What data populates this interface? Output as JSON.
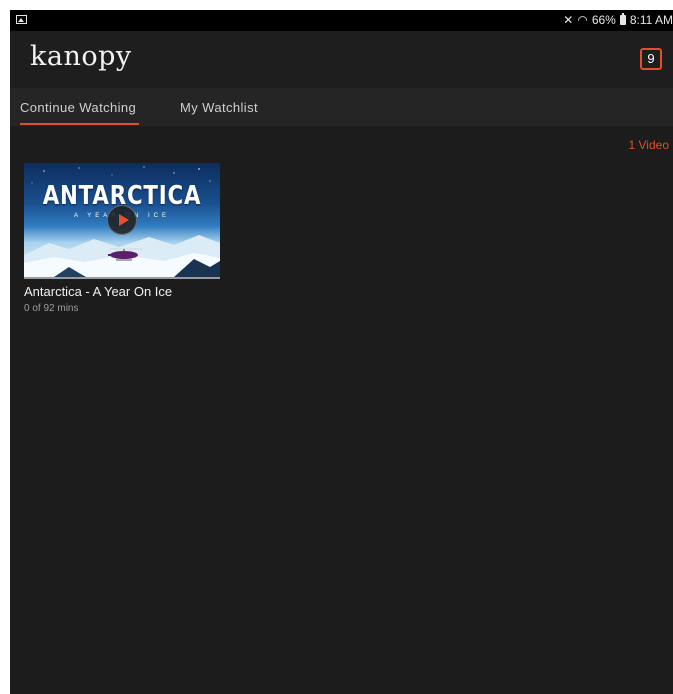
{
  "status_bar": {
    "battery": "66%",
    "time": "8:11 AM",
    "icons": [
      "gallery-icon",
      "mute-icon",
      "wifi-icon",
      "battery-icon"
    ]
  },
  "header": {
    "logo": "kanopy",
    "badge_count": "9"
  },
  "tabs": [
    {
      "label": "Continue Watching",
      "active": true
    },
    {
      "label": "My Watchlist",
      "active": false
    }
  ],
  "content": {
    "video_count": "1 Video",
    "videos": [
      {
        "title": "Antarctica - A Year On Ice",
        "meta": "0 of 92 mins",
        "thumbnail_title": "ANTARCTICA",
        "thumbnail_subtitle": "A YEAR ON ICE",
        "progress": 0
      }
    ]
  },
  "colors": {
    "accent": "#e0502a",
    "background": "#1c1c1c",
    "header": "#1e1e1e",
    "tabs": "#252525"
  }
}
